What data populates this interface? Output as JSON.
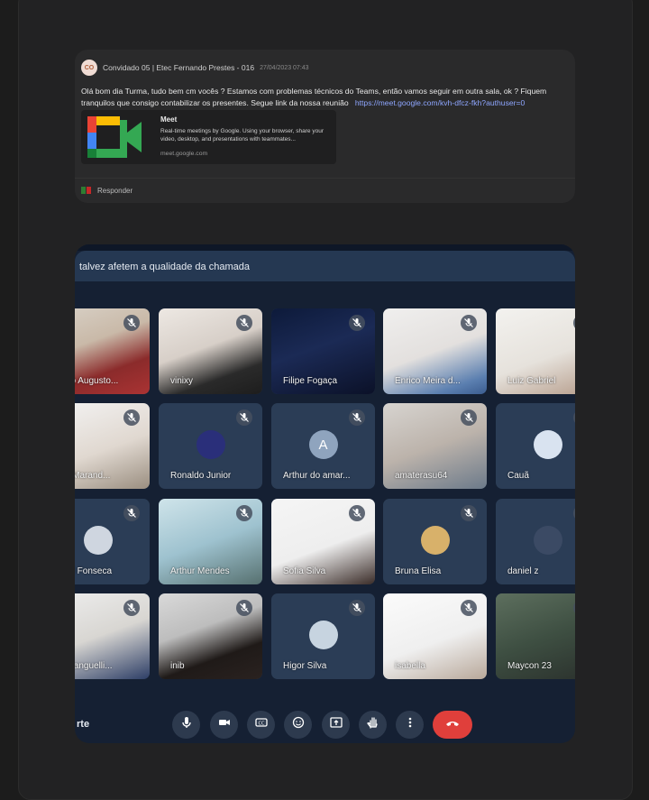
{
  "message": {
    "avatar_initials": "CO",
    "sender": "Convidado 05 | Etec Fernando Prestes - 016",
    "timestamp": "27/04/2023 07:43",
    "text": "Olá bom dia Turma, tudo bem cm vocês ? Estamos com problemas técnicos do Teams, então vamos seguir em outra sala, ok ? Fiquem tranquilos que consigo contabilizar os presentes. Segue link da nossa reunião",
    "link": "https://meet.google.com/kvh-dfcz-fkh?authuser=0",
    "preview": {
      "title": "Meet",
      "description": "Real-time meetings by Google. Using your browser, share your video, desktop, and presentations with teammates...",
      "domain": "meet.google.com"
    },
    "reply_label": "Responder"
  },
  "meet": {
    "banner_text": "talvez afetem a qualidade da chamada",
    "leave_label": "rte",
    "participants": [
      {
        "name": "ndro Augusto..."
      },
      {
        "name": "vinixy"
      },
      {
        "name": "Filipe Fogaça"
      },
      {
        "name": "Enrico Meira d..."
      },
      {
        "name": "Luiz Gabriel"
      },
      {
        "name": "ian Marand..."
      },
      {
        "name": "Ronaldo Junior"
      },
      {
        "name": "Arthur do amar...",
        "initial": "A"
      },
      {
        "name": "amaterasu64"
      },
      {
        "name": "Cauã"
      },
      {
        "name": "eriel Fonseca"
      },
      {
        "name": "Arthur Mendes"
      },
      {
        "name": "Sofia Silva"
      },
      {
        "name": "Bruna Elisa"
      },
      {
        "name": "daniel z"
      },
      {
        "name": "e Franguelli..."
      },
      {
        "name": "inib"
      },
      {
        "name": "Higor Silva"
      },
      {
        "name": "isabella"
      },
      {
        "name": "Maycon 23"
      }
    ],
    "controls": [
      "mic-icon",
      "camera-icon",
      "captions-icon",
      "emoji-icon",
      "present-icon",
      "raise-hand-icon",
      "more-icon",
      "end-call-icon"
    ]
  },
  "colors": {
    "accent_link": "#8ea6ff",
    "end_call": "#e03f3b",
    "tile": "#2b3d56"
  }
}
